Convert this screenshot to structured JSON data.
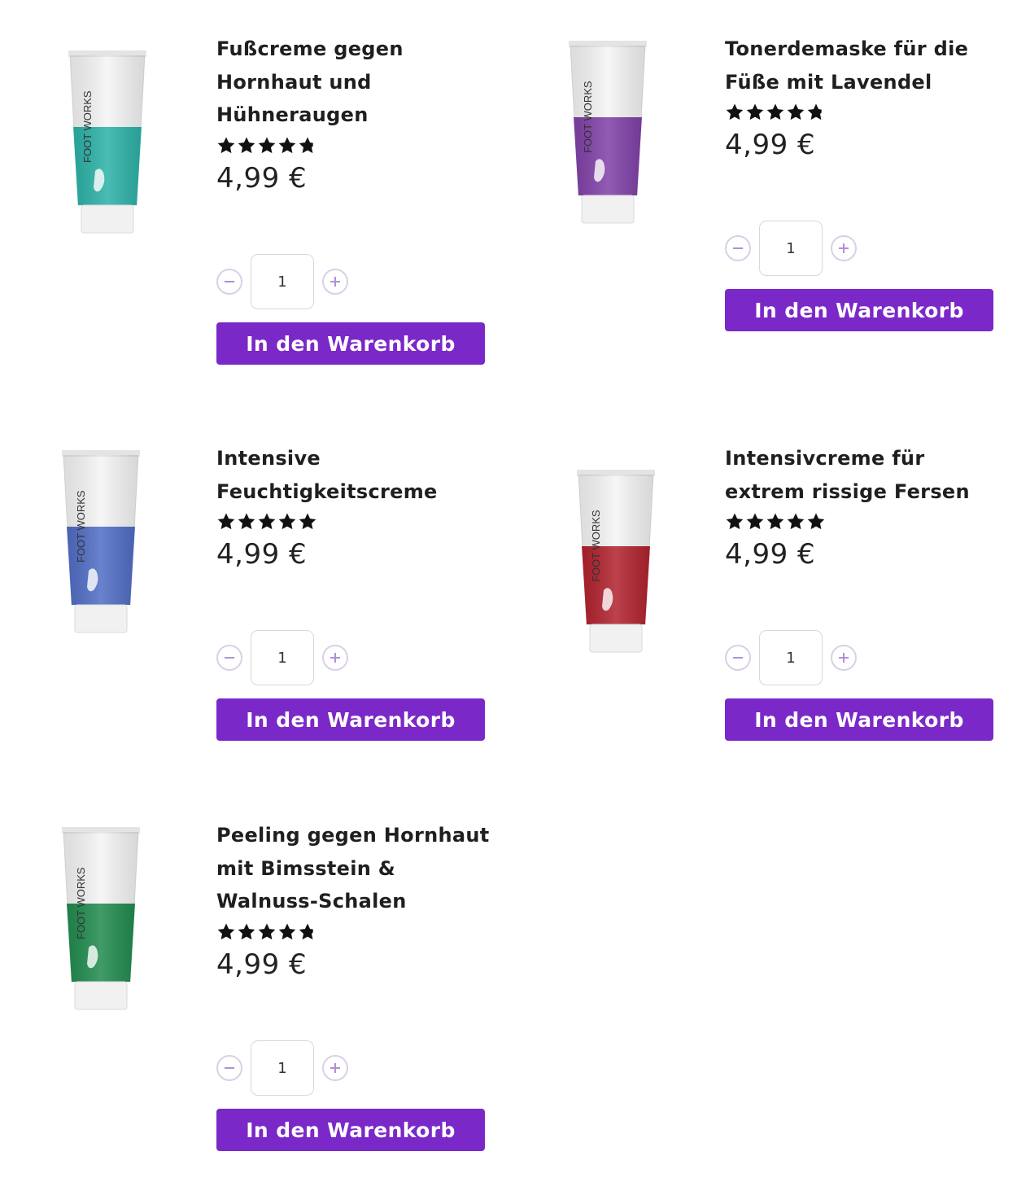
{
  "colors": {
    "accent": "#7b28c8",
    "qty_icon": "#b08fd9",
    "star": "#111111"
  },
  "products": [
    {
      "title_lines": [
        "Fußcreme gegen",
        "Hornhaut und",
        "Hühneraugen"
      ],
      "rating": 4.5,
      "price": "4,99 €",
      "quantity": "1",
      "cart_label": "In den Warenkorb",
      "image_brand": "FOOT WORKS",
      "tube_color": "#2ab1a6",
      "tube_icon": "footprint-icon"
    },
    {
      "title_lines": [
        "Tonerdemaske für die",
        "Füße mit Lavendel"
      ],
      "rating": 4.5,
      "price": "4,99 €",
      "quantity": "1",
      "cart_label": "In den Warenkorb",
      "image_brand": "FOOT WORKS",
      "tube_color": "#7f3fa6",
      "tube_icon": "footprint-icon"
    },
    {
      "title_lines": [
        "Intensive",
        "Feuchtigkeitscreme"
      ],
      "rating": 5,
      "price": "4,99 €",
      "quantity": "1",
      "cart_label": "In den Warenkorb",
      "image_brand": "FOOT WORKS",
      "tube_color": "#4f6cc4",
      "tube_icon": "footprint-icon"
    },
    {
      "title_lines": [
        "Intensivcreme für",
        "extrem rissige Fersen"
      ],
      "rating": 5,
      "price": "4,99 €",
      "quantity": "1",
      "cart_label": "In den Warenkorb",
      "image_brand": "FOOT WORKS",
      "tube_color": "#b0202c",
      "tube_icon": "footprint-icon"
    },
    {
      "title_lines": [
        "Peeling gegen Hornhaut",
        "mit Bimsstein &",
        "Walnuss-Schalen"
      ],
      "rating": 4.5,
      "price": "4,99 €",
      "quantity": "1",
      "cart_label": "In den Warenkorb",
      "image_brand": "FOOT WORKS",
      "tube_color": "#1f8a4c",
      "tube_icon": "footprint-icon"
    }
  ]
}
